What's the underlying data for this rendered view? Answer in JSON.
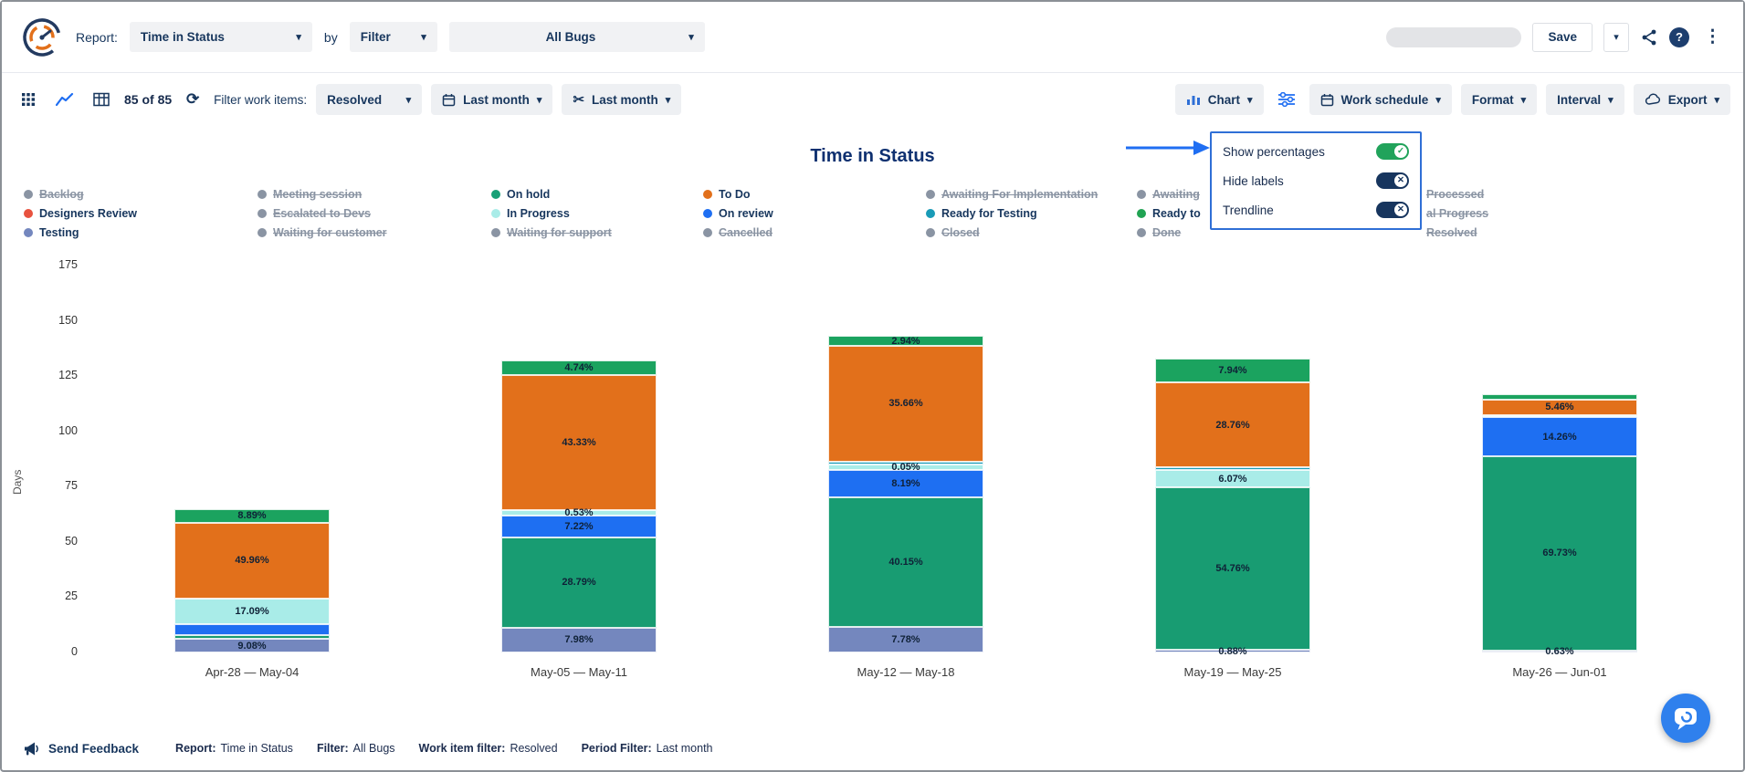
{
  "header": {
    "report_label": "Report:",
    "report_type": "Time in Status",
    "by_label": "by",
    "filter_mode": "Filter",
    "filter_value": "All Bugs",
    "save_label": "Save"
  },
  "toolbar": {
    "count_text": "85 of 85",
    "filter_work_items_label": "Filter work items:",
    "status_filter": "Resolved",
    "period_filter": "Last month",
    "sprint_filter": "Last month",
    "chart_label": "Chart",
    "work_schedule_label": "Work schedule",
    "format_label": "Format",
    "interval_label": "Interval",
    "export_label": "Export"
  },
  "settings_popup": {
    "items": [
      {
        "label": "Show percentages",
        "state": "on"
      },
      {
        "label": "Hide labels",
        "state": "off"
      },
      {
        "label": "Trendline",
        "state": "off"
      }
    ]
  },
  "legend": {
    "columns": [
      {
        "x": 24,
        "items": [
          {
            "label": "Backlog",
            "color": "#8a94a3",
            "active": false
          },
          {
            "label": "Designers Review",
            "color": "#e8523f",
            "active": true
          },
          {
            "label": "Testing",
            "color": "#7487be",
            "active": true
          }
        ]
      },
      {
        "x": 280,
        "items": [
          {
            "label": "Meeting session",
            "color": "#8a94a3",
            "active": false
          },
          {
            "label": "Escalated to Devs",
            "color": "#8a94a3",
            "active": false
          },
          {
            "label": "Waiting for customer",
            "color": "#8a94a3",
            "active": false
          }
        ]
      },
      {
        "x": 536,
        "items": [
          {
            "label": "On hold",
            "color": "#18a077",
            "active": true
          },
          {
            "label": "In Progress",
            "color": "#a9ece8",
            "active": true
          },
          {
            "label": "Waiting for support",
            "color": "#8a94a3",
            "active": false
          }
        ]
      },
      {
        "x": 768,
        "items": [
          {
            "label": "To Do",
            "color": "#e2701b",
            "active": true
          },
          {
            "label": "On review",
            "color": "#1e6ff2",
            "active": true
          },
          {
            "label": "Cancelled",
            "color": "#8a94a3",
            "active": false
          }
        ]
      },
      {
        "x": 1012,
        "items": [
          {
            "label": "Awaiting For Implementation",
            "color": "#8a94a3",
            "active": false
          },
          {
            "label": "Ready for Testing",
            "color": "#1a9bb7",
            "active": true
          },
          {
            "label": "Closed",
            "color": "#8a94a3",
            "active": false
          }
        ]
      },
      {
        "x": 1243,
        "items": [
          {
            "label": "Awaiting",
            "color": "#8a94a3",
            "active": false
          },
          {
            "label": "Ready to",
            "color": "#21a353",
            "active": true
          },
          {
            "label": "Done",
            "color": "#8a94a3",
            "active": false
          }
        ]
      },
      {
        "x": 1560,
        "items": [
          {
            "label": "Processed",
            "color": "#8a94a3",
            "active": false,
            "show_dot": false
          },
          {
            "label": "al Progress",
            "color": "#8a94a3",
            "active": false,
            "show_dot": false
          },
          {
            "label": "Resolved",
            "color": "#8a94a3",
            "active": false,
            "show_dot": false
          }
        ]
      }
    ]
  },
  "chart_data": {
    "type": "stacked-bar",
    "title": "Time in Status",
    "ylabel": "Days",
    "ylim": [
      0,
      175
    ],
    "yticks": [
      0,
      25,
      50,
      75,
      100,
      125,
      150,
      175
    ],
    "grid": false,
    "categories": [
      "Apr-28 — May-04",
      "May-05 — May-11",
      "May-12 — May-18",
      "May-19 — May-25",
      "May-26 — Jun-01"
    ],
    "bars": [
      {
        "category": "Apr-28 — May-04",
        "segments": [
          {
            "status": "Testing",
            "color": "#7487be",
            "days": 6.2,
            "label": "9.08%"
          },
          {
            "status": "On hold",
            "color": "#189c72",
            "days": 1.6,
            "label": ""
          },
          {
            "status": "On review",
            "color": "#1e6ff2",
            "days": 5.0,
            "label": ""
          },
          {
            "status": "In Progress",
            "color": "#a9ece8",
            "days": 11.7,
            "label": "17.09%"
          },
          {
            "status": "To Do",
            "color": "#e2701b",
            "days": 34.2,
            "label": "49.96%"
          },
          {
            "status": "Ready to",
            "color": "#1ba35f",
            "days": 6.1,
            "label": "8.89%"
          }
        ]
      },
      {
        "category": "May-05 — May-11",
        "segments": [
          {
            "status": "Testing",
            "color": "#7487be",
            "days": 11.3,
            "label": "7.98%"
          },
          {
            "status": "On hold",
            "color": "#189c72",
            "days": 40.6,
            "label": "28.79%"
          },
          {
            "status": "On review",
            "color": "#1e6ff2",
            "days": 10.2,
            "label": "7.22%"
          },
          {
            "status": "In Progress",
            "color": "#a9ece8",
            "days": 2.2,
            "label": "0.53%"
          },
          {
            "status": "To Do",
            "color": "#e2701b",
            "days": 61.1,
            "label": "43.33%"
          },
          {
            "status": "Ready to",
            "color": "#1ba35f",
            "days": 6.7,
            "label": "4.74%"
          }
        ]
      },
      {
        "category": "May-12 — May-18",
        "segments": [
          {
            "status": "Testing",
            "color": "#7487be",
            "days": 11.4,
            "label": "7.78%"
          },
          {
            "status": "On hold",
            "color": "#189c72",
            "days": 59.0,
            "label": "40.15%"
          },
          {
            "status": "On review",
            "color": "#1e6ff2",
            "days": 12.0,
            "label": "8.19%"
          },
          {
            "status": "In Progress",
            "color": "#a9ece8",
            "days": 2.5,
            "label": "0.05%"
          },
          {
            "status": "Ready for Testing",
            "color": "#1a9bb7",
            "days": 1.5,
            "label": ""
          },
          {
            "status": "To Do",
            "color": "#e2701b",
            "days": 52.4,
            "label": "35.66%"
          },
          {
            "status": "Ready to",
            "color": "#1ba35f",
            "days": 4.3,
            "label": "2.94%"
          }
        ]
      },
      {
        "category": "May-19 — May-25",
        "segments": [
          {
            "status": "Testing",
            "color": "#7487be",
            "days": 1.2,
            "label": "0.88%"
          },
          {
            "status": "On hold",
            "color": "#189c72",
            "days": 73.4,
            "label": "54.76%"
          },
          {
            "status": "In Progress",
            "color": "#a9ece8",
            "days": 8.1,
            "label": "6.07%"
          },
          {
            "status": "Ready for Testing",
            "color": "#1a9bb7",
            "days": 1.0,
            "label": ""
          },
          {
            "status": "To Do",
            "color": "#e2701b",
            "days": 38.5,
            "label": "28.76%"
          },
          {
            "status": "Ready to",
            "color": "#1ba35f",
            "days": 10.6,
            "label": "7.94%"
          }
        ]
      },
      {
        "category": "May-26 — Jun-01",
        "segments": [
          {
            "status": "Testing",
            "color": "#7487be",
            "days": 0.9,
            "label": "0.63%"
          },
          {
            "status": "On hold",
            "color": "#189c72",
            "days": 88.0,
            "label": "69.73%"
          },
          {
            "status": "On review",
            "color": "#1e6ff2",
            "days": 17.4,
            "label": "14.26%"
          },
          {
            "status": "In Progress",
            "color": "#a9ece8",
            "days": 1.2,
            "label": ""
          },
          {
            "status": "To Do",
            "color": "#e2701b",
            "days": 6.7,
            "label": "5.46%"
          },
          {
            "status": "Ready to",
            "color": "#1ba35f",
            "days": 2.5,
            "label": ""
          }
        ]
      }
    ]
  },
  "footer": {
    "send_feedback": "Send Feedback",
    "summary": [
      {
        "label": "Report:",
        "value": "Time in Status"
      },
      {
        "label": "Filter:",
        "value": "All Bugs"
      },
      {
        "label": "Work item filter:",
        "value": "Resolved"
      },
      {
        "label": "Period Filter:",
        "value": "Last month"
      }
    ]
  },
  "colors": {
    "accent_blue": "#1f6ef2",
    "navy": "#17365d",
    "popup_border": "#2f6fd6",
    "toggle_on": "#21a35b",
    "toggle_off": "#17355e",
    "fab_blue": "#2f80ed"
  }
}
